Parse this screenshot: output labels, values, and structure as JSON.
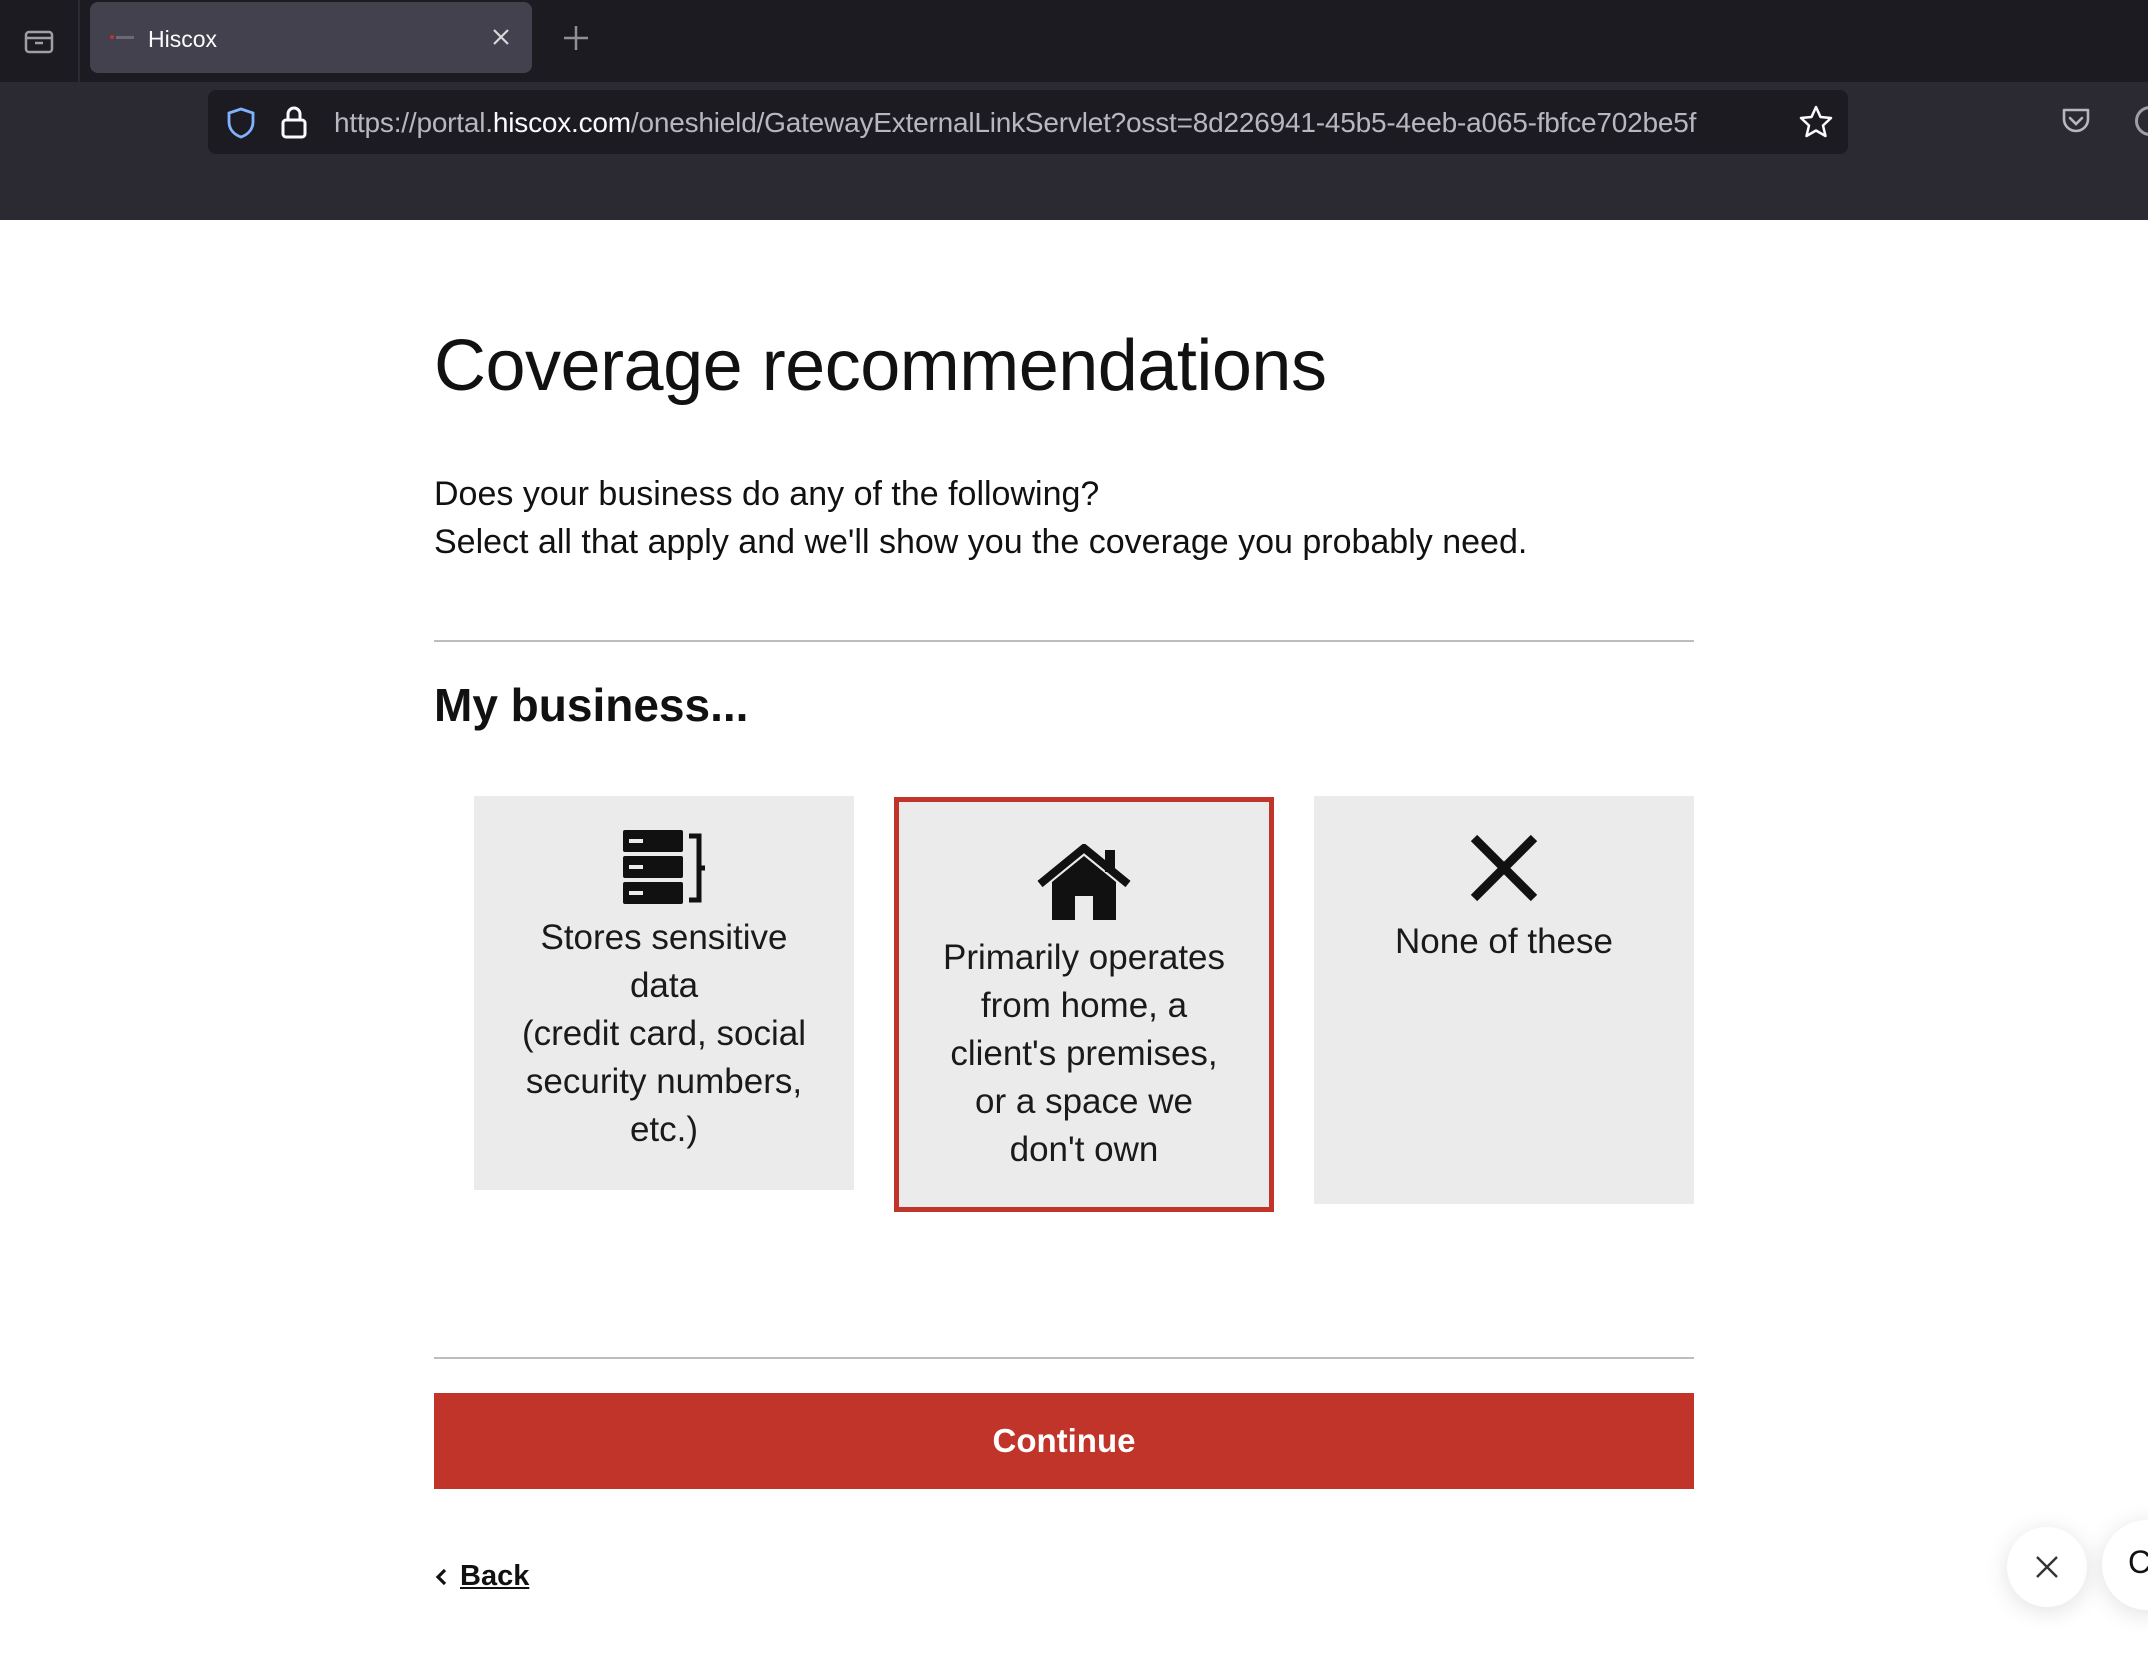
{
  "browser": {
    "tab": {
      "title": "Hiscox",
      "favicon": "hiscox-favicon"
    },
    "url": {
      "prefix": "https://portal.",
      "host": "hiscox.com",
      "path": "/oneshield/GatewayExternalLinkServlet?osst=8d226941-45b5-4eeb-a065-fbfce702be5f"
    },
    "icons": {
      "tab_overview": "tab-overview-icon",
      "close_tab": "close-icon",
      "new_tab": "plus-icon",
      "tracking": "shield-icon",
      "lock": "lock-icon",
      "bookmark": "star-icon",
      "pocket": "pocket-icon"
    }
  },
  "page": {
    "title": "Coverage recommendations",
    "intro_line1": "Does your business do any of the following?",
    "intro_line2": "Select all that apply and we'll show you the coverage you probably need.",
    "section_title": "My business...",
    "options": [
      {
        "label_lines": [
          "Stores sensitive",
          "data",
          "(credit card, social",
          "security numbers,",
          "etc.)"
        ],
        "icon": "server-database-icon",
        "selected": false
      },
      {
        "label_lines": [
          "Primarily operates",
          "from home, a",
          "client's premises,",
          "or a space we",
          "don't own"
        ],
        "icon": "home-icon",
        "selected": true
      },
      {
        "label_lines": [
          "None of these"
        ],
        "icon": "x-icon",
        "selected": false
      }
    ],
    "continue_label": "Continue",
    "back_label": "Back",
    "chat_fragment": "C"
  },
  "colors": {
    "brand_red": "#c0342a",
    "card_bg": "#ebebeb",
    "chrome_dark": "#1c1b22",
    "chrome_mid": "#2b2a33"
  }
}
